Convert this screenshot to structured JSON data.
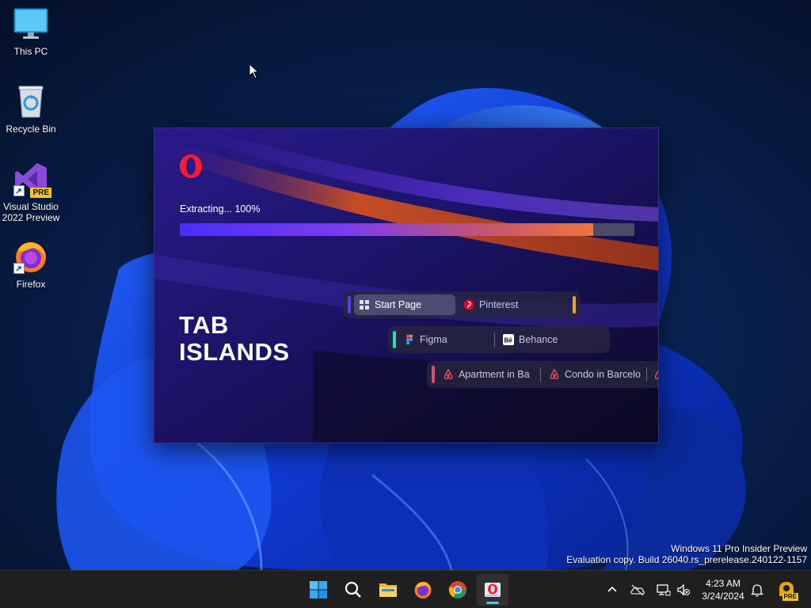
{
  "desktop": {
    "icons": [
      {
        "label": "This PC"
      },
      {
        "label": "Recycle Bin"
      },
      {
        "label": "Visual Studio 2022 Preview",
        "badge": "PRE"
      },
      {
        "label": "Firefox"
      }
    ]
  },
  "installer": {
    "status_text": "Extracting... 100%",
    "progress_percent": 100,
    "headline_line1": "TAB",
    "headline_line2": "ISLANDS",
    "islands": [
      {
        "accent": "#5b3cf5",
        "end_accent": "#f0a030",
        "tabs": [
          {
            "label": "Start Page",
            "icon": "grid-icon",
            "active": true
          },
          {
            "label": "Pinterest",
            "icon": "pinterest-icon",
            "active": false
          }
        ]
      },
      {
        "accent": "#36d3b0",
        "tabs": [
          {
            "label": "Figma",
            "icon": "figma-icon",
            "active": false
          },
          {
            "label": "Behance",
            "icon": "behance-icon",
            "active": false
          }
        ]
      },
      {
        "accent": "#e0506a",
        "tabs": [
          {
            "label": "Apartment in Ba",
            "icon": "airbnb-icon",
            "active": false
          },
          {
            "label": "Condo in Barcelo",
            "icon": "airbnb-icon",
            "active": false
          }
        ]
      }
    ]
  },
  "watermark": {
    "line1": "Windows 11 Pro Insider Preview",
    "line2": "Evaluation copy. Build 26040.rs_prerelease.240122-1157"
  },
  "taskbar": {
    "apps": [
      "start-icon",
      "search-icon",
      "file-explorer-icon",
      "firefox-icon",
      "chrome-icon",
      "opera-installer-icon"
    ],
    "time": "4:23 AM",
    "date": "3/24/2024",
    "tray_badge": "PRE"
  },
  "colors": {
    "accent_blue": "#4cc2ff",
    "progress_start": "#4b2dfa",
    "progress_end": "#f0743e",
    "opera_red": "#ff1b2d"
  }
}
